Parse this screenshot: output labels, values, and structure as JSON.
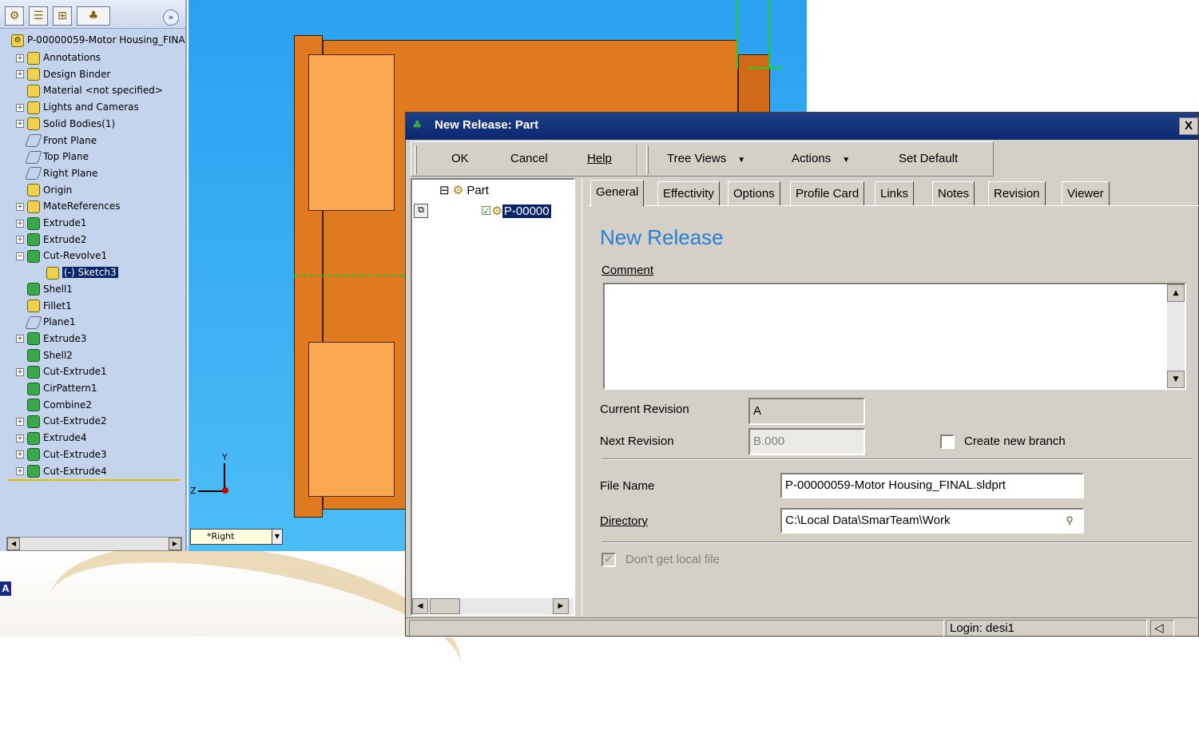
{
  "feature_manager": {
    "toolbar_icons": [
      "feature-tree-icon",
      "property-icon",
      "configuration-icon",
      "display-icon"
    ],
    "expand_glyph": "»",
    "root": "P-00000059-Motor Housing_FINA",
    "items": [
      {
        "label": "Annotations",
        "icon": "annotation-icon",
        "expand": "+"
      },
      {
        "label": "Design Binder",
        "icon": "binder-icon",
        "expand": "+"
      },
      {
        "label": "Material <not specified>",
        "icon": "material-icon",
        "expand": ""
      },
      {
        "label": "Lights and Cameras",
        "icon": "lights-icon",
        "expand": "+"
      },
      {
        "label": "Solid Bodies(1)",
        "icon": "bodies-icon",
        "expand": "+"
      },
      {
        "label": "Front Plane",
        "icon": "plane-icon",
        "expand": ""
      },
      {
        "label": "Top Plane",
        "icon": "plane-icon",
        "expand": ""
      },
      {
        "label": "Right Plane",
        "icon": "plane-icon",
        "expand": ""
      },
      {
        "label": "Origin",
        "icon": "origin-icon",
        "expand": ""
      },
      {
        "label": "MateReferences",
        "icon": "mate-icon",
        "expand": "+"
      },
      {
        "label": "Extrude1",
        "icon": "extrude-icon",
        "expand": "+"
      },
      {
        "label": "Extrude2",
        "icon": "extrude-icon",
        "expand": "+"
      },
      {
        "label": "Cut-Revolve1",
        "icon": "revolve-icon",
        "expand": "−"
      },
      {
        "label": "(-) Sketch3",
        "icon": "sketch-icon",
        "expand": "",
        "selected": true,
        "indent": true
      },
      {
        "label": "Shell1",
        "icon": "shell-icon",
        "expand": ""
      },
      {
        "label": "Fillet1",
        "icon": "fillet-icon",
        "expand": ""
      },
      {
        "label": "Plane1",
        "icon": "plane-icon",
        "expand": ""
      },
      {
        "label": "Extrude3",
        "icon": "extrude-icon",
        "expand": "+"
      },
      {
        "label": "Shell2",
        "icon": "shell-icon",
        "expand": ""
      },
      {
        "label": "Cut-Extrude1",
        "icon": "cut-extrude-icon",
        "expand": "+"
      },
      {
        "label": "CirPattern1",
        "icon": "pattern-icon",
        "expand": ""
      },
      {
        "label": "Combine2",
        "icon": "combine-icon",
        "expand": ""
      },
      {
        "label": "Cut-Extrude2",
        "icon": "cut-extrude-icon",
        "expand": "+"
      },
      {
        "label": "Extrude4",
        "icon": "extrude-icon",
        "expand": "+"
      },
      {
        "label": "Cut-Extrude3",
        "icon": "cut-extrude-icon",
        "expand": "+"
      },
      {
        "label": "Cut-Extrude4",
        "icon": "cut-extrude-icon",
        "expand": "+"
      }
    ]
  },
  "viewport": {
    "view_name": "*Right",
    "axis_y": "Y",
    "axis_z": "Z"
  },
  "dialog": {
    "title": "New Release: Part",
    "close": "X",
    "toolbar": {
      "ok": "OK",
      "cancel": "Cancel",
      "help": "Help",
      "tree_views": "Tree Views",
      "actions": "Actions",
      "set_default": "Set Default",
      "caret": "▼"
    },
    "tree": {
      "root": "Part",
      "child": "P-00000",
      "expand": "⊟"
    },
    "tabs": [
      "General",
      "Effectivity",
      "Options",
      "Profile Card",
      "Links",
      "Notes",
      "Revision",
      "Viewer"
    ],
    "heading": "New Release",
    "comment_label": "Comment",
    "comment_value": "",
    "current_revision_label": "Current Revision",
    "current_revision": "A",
    "next_revision_label": "Next Revision",
    "next_revision": "B.000",
    "create_branch_label": "Create new branch",
    "file_name_label": "File Name",
    "file_name": "P-00000059-Motor Housing_FINAL.sldprt",
    "directory_label": "Directory",
    "directory": "C:\\Local Data\\SmarTeam\\Work",
    "dont_get_local_label": "Don't get local file",
    "status_login": "Login: desi1"
  },
  "colors": {
    "accent_heading": "#2a7fd4",
    "title_bar": "#0a246a",
    "part_orange": "#e07a20"
  }
}
